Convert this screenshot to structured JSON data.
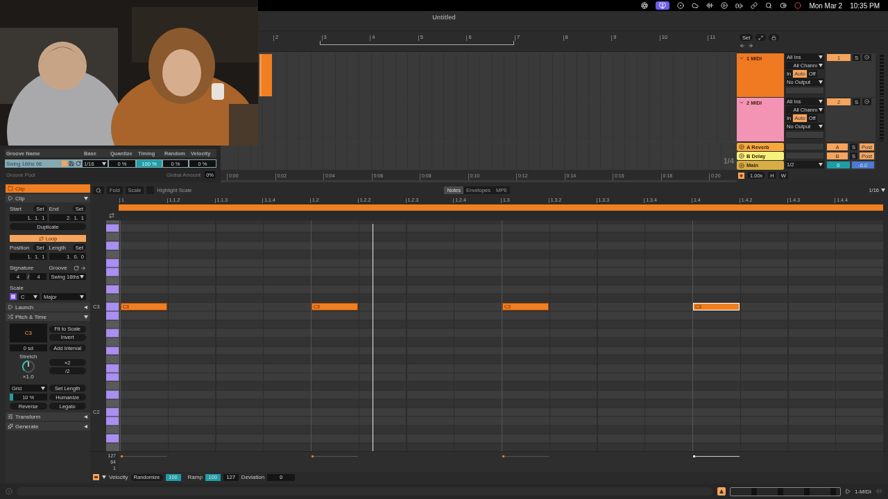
{
  "menubar": {
    "date": "Mon Mar 2",
    "time": "10:35 PM"
  },
  "window": {
    "title": "Untitled"
  },
  "groove_pool": {
    "columns": [
      "Groove Name",
      "Base",
      "Quantize",
      "Timing",
      "Random",
      "Velocity"
    ],
    "rows": [
      {
        "name": "Swing 16ths 66",
        "base": "1/16",
        "quantize": "0 %",
        "timing": "100 %",
        "random": "0 %",
        "velocity": "0 %",
        "selected": true
      }
    ],
    "title": "Groove Pool",
    "global_amount_label": "Global Amount",
    "global_amount": "0%"
  },
  "arrangement": {
    "bars": [
      "2",
      "3",
      "4",
      "5",
      "6",
      "7",
      "8",
      "9",
      "10",
      "11"
    ],
    "times": [
      "0:00",
      "0:02",
      "0:04",
      "0:06",
      "0:08",
      "0:10",
      "0:12",
      "0:14",
      "0:16",
      "0:18",
      "0:20"
    ],
    "set_button": "Set",
    "meter": "1/4"
  },
  "tracks": [
    {
      "name": "1 MIDI",
      "color": "#ef7a22",
      "input": "All Ins",
      "channel": "All Channı",
      "monitor": [
        {
          "label": "In",
          "selected": false
        },
        {
          "label": "Auto",
          "selected": true
        },
        {
          "label": "Off",
          "selected": false
        }
      ],
      "output": "No Output",
      "number": "1",
      "solo": "S"
    },
    {
      "name": "2 MIDI",
      "color": "#f394b5",
      "input": "All Ins",
      "channel": "All Channı",
      "monitor": [
        {
          "label": "In",
          "selected": false
        },
        {
          "label": "Auto",
          "selected": true
        },
        {
          "label": "Off",
          "selected": false
        }
      ],
      "output": "No Output",
      "number": "2",
      "solo": "S"
    }
  ],
  "returns": [
    {
      "name": "A Reverb",
      "color": "#f7a93c",
      "send": "A",
      "solo": "S",
      "post": "Post"
    },
    {
      "name": "B Delay",
      "color": "#f6f07c",
      "send": "B",
      "solo": "S",
      "post": "Post"
    }
  ],
  "main": {
    "name": "Main",
    "color": "#d7ad44",
    "output": "1/2",
    "volume": "0",
    "pan": "-6.0"
  },
  "mixer_footer": {
    "zoom": "1.00x",
    "h": "H",
    "w": "W"
  },
  "clip": {
    "title": "Clip",
    "section": {
      "label": "Clip",
      "expanded": true
    },
    "start": {
      "label": "Start",
      "set": "Set",
      "value": "1.  1.  1"
    },
    "end": {
      "label": "End",
      "set": "Set",
      "value": "2.  1.  1"
    },
    "duplicate": "Duplicate",
    "loop": {
      "label": "Loop",
      "on": true
    },
    "position": {
      "label": "Position",
      "set": "Set",
      "value": "1.  1.  1"
    },
    "length": {
      "label": "Length",
      "set": "Set",
      "value": "1.  0.  0"
    },
    "signature": {
      "label": "Signature",
      "numerator": "4",
      "separator": "/",
      "denominator": "4"
    },
    "groove": {
      "label": "Groove",
      "value": "Swing 16ths"
    },
    "scale": {
      "label": "Scale",
      "root": "C",
      "mode": "Major"
    }
  },
  "sections": [
    {
      "label": "Launch",
      "expanded": false
    },
    {
      "label": "Pitch & Time",
      "expanded": true
    }
  ],
  "pitch_time": {
    "note": "C3",
    "fit_to_scale": "Fit to Scale",
    "invert": "Invert",
    "transpose": "0 sd",
    "add_interval": "Add Interval",
    "stretch": {
      "label": "Stretch",
      "value": "×1.0"
    },
    "double": "×2",
    "half": "/2",
    "grid": "Grid",
    "set_length": "Set Length",
    "humanize": {
      "amount": "10 %",
      "level": 0.1,
      "button": "Humanize"
    },
    "reverse": "Reverse",
    "legato": "Legato"
  },
  "more_sections": [
    {
      "label": "Transform",
      "expanded": false
    },
    {
      "label": "Generate",
      "expanded": false
    }
  ],
  "piano_roll": {
    "fold": "Fold",
    "scale": "Scale",
    "highlight_scale": {
      "label": "Highlight Scale",
      "checked": false
    },
    "tabs": [
      {
        "label": "Notes",
        "selected": true
      },
      {
        "label": "Envelopes",
        "selected": false
      },
      {
        "label": "MPE",
        "selected": false
      }
    ],
    "grid": "1/16",
    "ruler": [
      "1",
      "1.1.2",
      "1.1.3",
      "1.1.4",
      "1.2",
      "1.2.2",
      "1.2.3",
      "1.2.4",
      "1.3",
      "1.3.2",
      "1.3.3",
      "1.3.4",
      "1.4",
      "1.4.2",
      "1.4.3",
      "1.4.4"
    ],
    "key_labels": [
      "C3",
      "C2"
    ],
    "notes": [
      {
        "label": "C3",
        "selected": false
      },
      {
        "label": "C3",
        "selected": false
      },
      {
        "label": "C3",
        "selected": false
      },
      {
        "label": "C3",
        "selected": true
      }
    ],
    "velocity_scale": [
      "127",
      "64",
      "1"
    ]
  },
  "velocity_bar": {
    "label": "Velocity",
    "randomize": "Randomize",
    "randomize_value": "100",
    "ramp": "Ramp",
    "ramp_value": "100",
    "ramp_end": "127",
    "deviation": "Deviation",
    "deviation_value": "0"
  },
  "status_bar": {
    "track": "1-MIDI"
  }
}
